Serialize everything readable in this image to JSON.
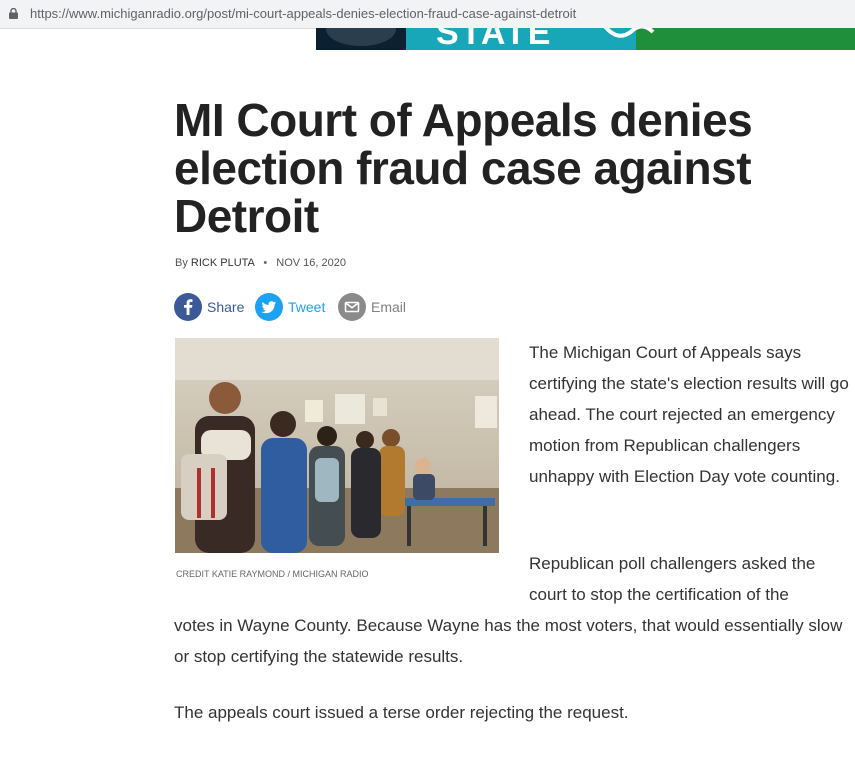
{
  "browser": {
    "url": "https://www.michiganradio.org/post/mi-court-appeals-denies-election-fraud-case-against-detroit"
  },
  "ad": {
    "text": "STATE"
  },
  "article": {
    "headline": "MI Court of Appeals denies election fraud case against Detroit",
    "byline_prefix": "By",
    "author": "RICK PLUTA",
    "separator": "•",
    "date": "NOV 16, 2020",
    "share": {
      "facebook_label": "Share",
      "twitter_label": "Tweet",
      "email_label": "Email"
    },
    "photo": {
      "caption": "CREDIT KATIE RAYMOND / MICHIGAN RADIO"
    },
    "paragraphs": {
      "p1": "The Michigan Court of Appeals says certifying the state's election results will go ahead. The court rejected an emergency motion from Republican challengers unhappy with Election Day vote counting.",
      "p2_first": "Republican poll challengers asked the court to stop the certification of the",
      "p2_rest": "votes in Wayne County. Because Wayne has the most voters, that would essentially slow or stop certifying the statewide results.",
      "p3": "The appeals court issued a terse order rejecting the request."
    }
  },
  "colors": {
    "facebook": "#3b5998",
    "twitter": "#1da1f2",
    "email": "#8a8a8a"
  }
}
